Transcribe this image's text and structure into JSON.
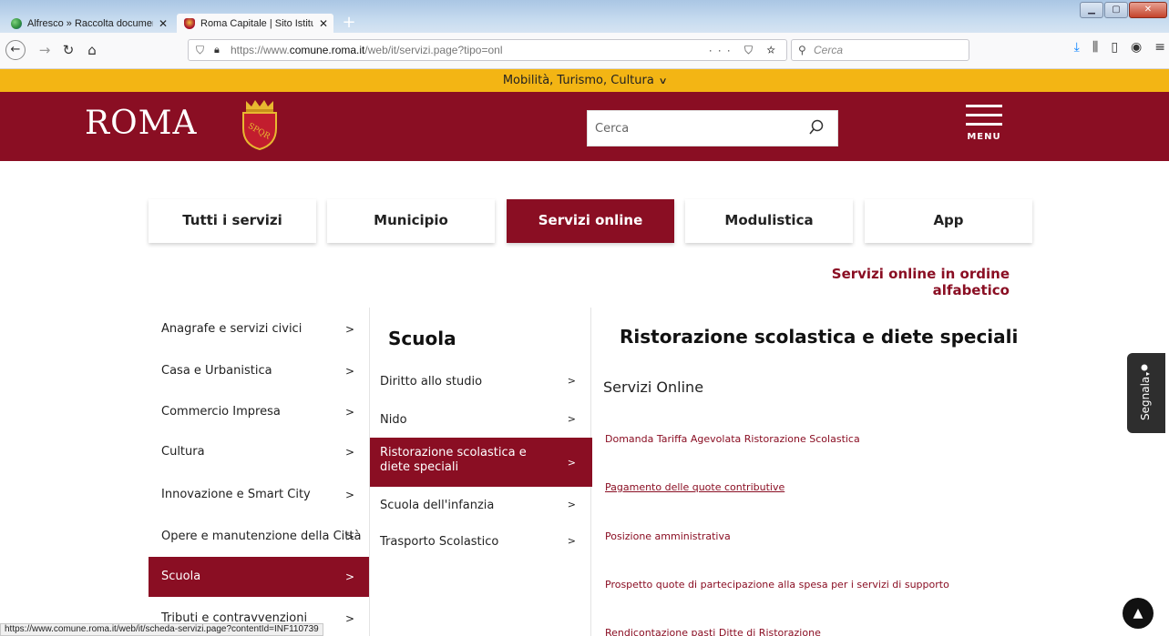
{
  "browser": {
    "tabs": [
      {
        "label": "Alfresco » Raccolta documenti",
        "close": "✕"
      },
      {
        "label": "Roma Capitale | Sito Istituzionale",
        "close": "✕"
      }
    ],
    "new_tab": "+",
    "window_buttons": [
      "▁",
      "▢",
      "✕"
    ],
    "url_prefix": "https://www.",
    "url_domain": "comune.roma.it",
    "url_path": "/web/it/servizi.page?tipo=onl",
    "page_actions": "··· ⛉ ☆",
    "search_placeholder": "Cerca",
    "status_url": "https://www.comune.roma.it/web/it/scheda-servizi.page?contentId=INF110739"
  },
  "site": {
    "top_strip": "Mobilità, Turismo, Cultura",
    "logo": "ROMA",
    "crest_text": "SPQR",
    "search_placeholder": "Cerca",
    "menu_label": "MENU",
    "brand_color": "#8a0e23",
    "accent_color": "#f3b514"
  },
  "main_tabs": [
    "Tutti i servizi",
    "Municipio",
    "Servizi online",
    "Modulistica",
    "App"
  ],
  "alpha_link": "Servizi online in ordine alfabetico",
  "categories": [
    "Anagrafe e servizi civici",
    "Casa e Urbanistica",
    "Commercio Impresa",
    "Cultura",
    "Innovazione e Smart City",
    "Opere e manutenzione della Città",
    "Scuola",
    "Tributi e contravvenzioni"
  ],
  "arrow": ">",
  "subnav": {
    "title": "Scuola",
    "items": [
      "Diritto allo studio",
      "Nido",
      "Ristorazione scolastica e diete speciali",
      "Scuola dell'infanzia",
      "Trasporto Scolastico"
    ]
  },
  "content": {
    "title": "Ristorazione scolastica e diete speciali",
    "subtitle": "Servizi Online",
    "links": [
      "Domanda Tariffa Agevolata Ristorazione Scolastica",
      "Pagamento delle quote contributive",
      "Posizione amministrativa",
      "Prospetto quote di partecipazione alla spesa per i servizi di supporto",
      "Rendicontazione pasti Ditte di Ristorazione"
    ]
  },
  "widgets": {
    "segnala": "Segnala",
    "scroll_top": "▲"
  }
}
